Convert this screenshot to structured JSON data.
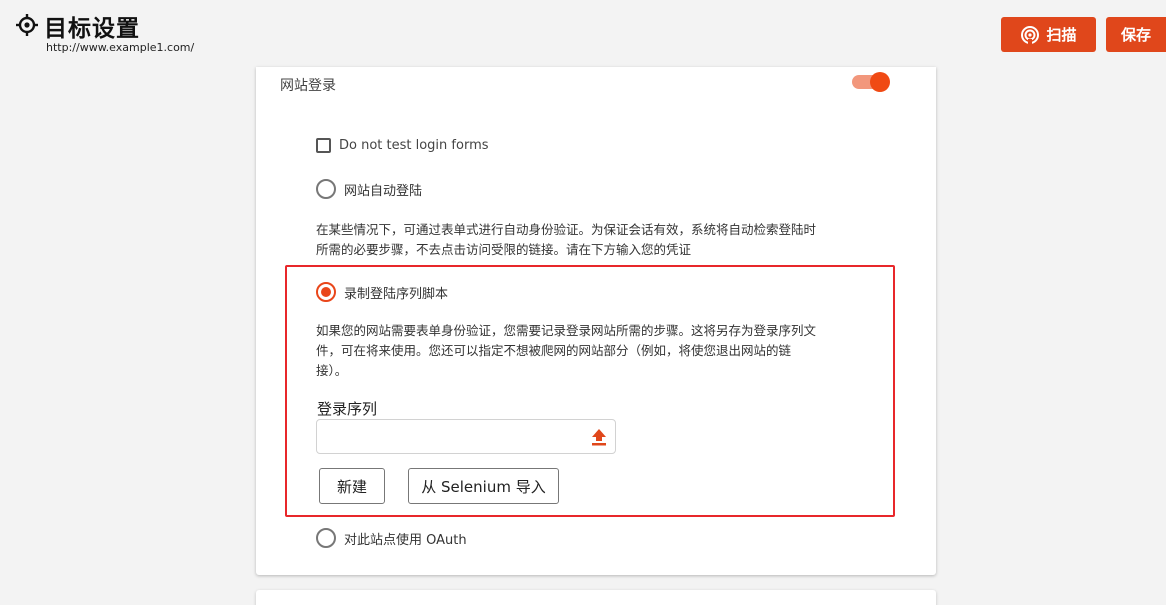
{
  "header": {
    "title": "目标设置",
    "url": "http://www.example1.com/",
    "scan_label": "扫描",
    "save_label": "保存"
  },
  "section": {
    "title": "网站登录",
    "toggle_on": true
  },
  "options": {
    "no_test_label": "Do not test login forms",
    "auto_login_label": "网站自动登陆",
    "auto_login_desc_line1": "在某些情况下，可通过表单式进行自动身份验证。为保证会话有效，系统将自动检索登陆时",
    "auto_login_desc_line2": "所需的必要步骤，不去点击访问受限的链接。请在下方输入您的凭证",
    "record_label": "录制登陆序列脚本",
    "record_desc_line1": "如果您的网站需要表单身份验证，您需要记录登录网站所需的步骤。这将另存为登录序列文",
    "record_desc_line2": "件，可在将来使用。您还可以指定不想被爬网的网站部分（例如，将使您退出网站的链",
    "record_desc_line3": "接）。",
    "sequence_label": "登录序列",
    "sequence_value": "",
    "new_label": "新建",
    "import_label": "从 Selenium 导入",
    "oauth_label": "对此站点使用 OAuth"
  },
  "colors": {
    "accent": "#e0471b",
    "highlight_border": "#e8272a"
  },
  "icons": [
    "target-icon",
    "scan-icon",
    "upload-icon"
  ]
}
